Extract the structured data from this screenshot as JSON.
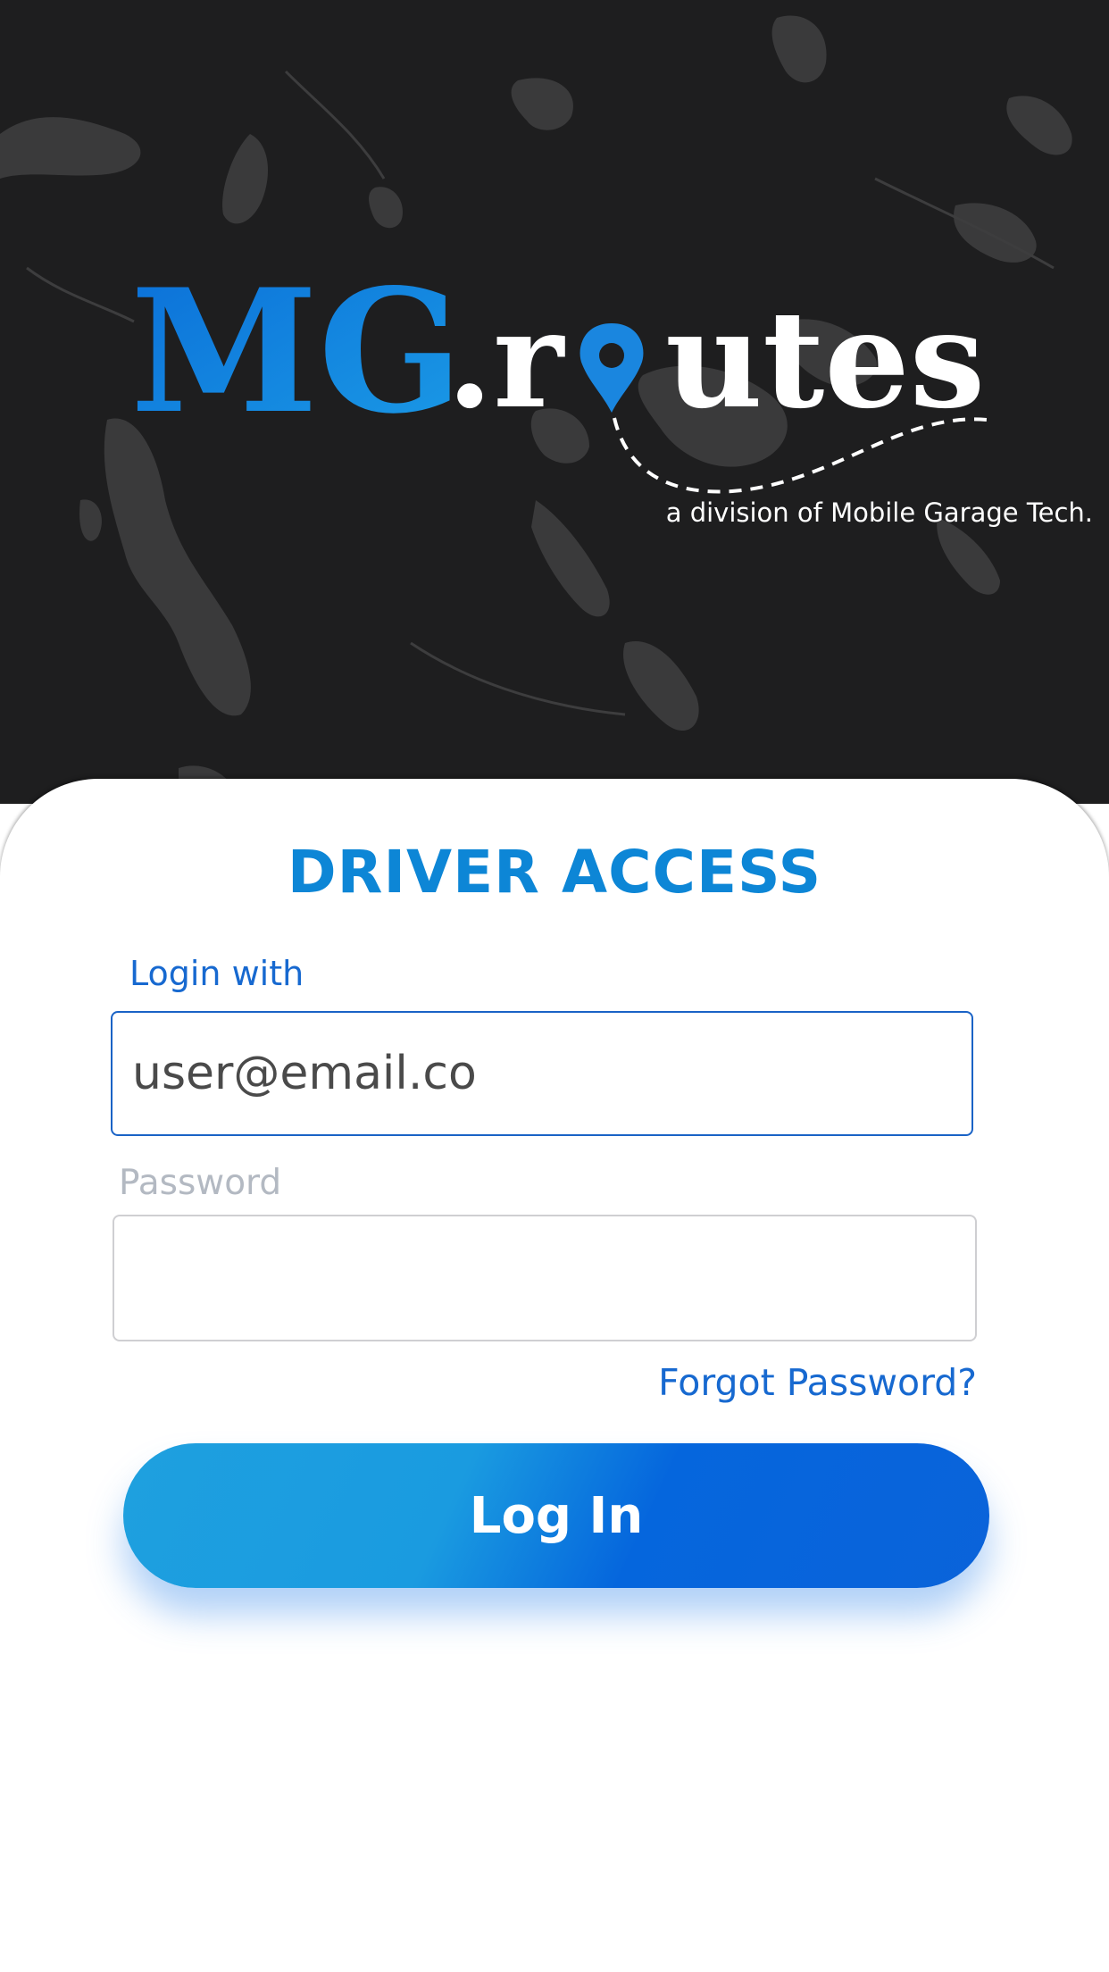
{
  "brand": {
    "logo_part1": "MG",
    "logo_part2": ".r",
    "logo_part3": "utes",
    "tagline": "a division of Mobile Garage Tech."
  },
  "login": {
    "title": "DRIVER ACCESS",
    "login_label": "Login with",
    "email_value": "user@email.co",
    "password_label": "Password",
    "password_value": "",
    "forgot_password": "Forgot Password?",
    "login_button": "Log In"
  },
  "colors": {
    "accent": "#0d86d6",
    "link": "#1769d0",
    "header_bg": "#1e1e1f",
    "button_start": "#1ea0df",
    "button_end": "#0566dd"
  },
  "icons": {
    "logo_o": "map-pin-icon",
    "background": "world-map"
  }
}
